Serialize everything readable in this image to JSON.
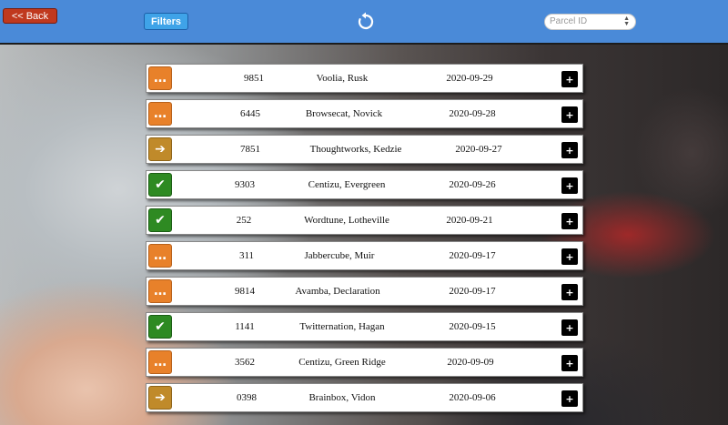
{
  "header": {
    "back_label": "<< Back",
    "filters_label": "Filters",
    "refresh_icon": "refresh-icon",
    "parcel_select_placeholder": "Parcel ID"
  },
  "status_symbols": {
    "pending": "…",
    "transit": "➔",
    "done": "✔"
  },
  "colors": {
    "header": "#4a8ad8",
    "back_button": "#c0391e",
    "filters_button": "#3fa3e8",
    "pending": "#e8812a",
    "transit": "#c08a2a",
    "done": "#2e8a22"
  },
  "parcels": [
    {
      "status": "pending",
      "id": "9851",
      "name": "Voolia, Rusk",
      "date": "2020-09-29"
    },
    {
      "status": "pending",
      "id": "6445",
      "name": "Browsecat, Novick",
      "date": "2020-09-28"
    },
    {
      "status": "transit",
      "id": "7851",
      "name": "Thoughtworks, Kedzie",
      "date": "2020-09-27"
    },
    {
      "status": "done",
      "id": "9303",
      "name": "Centizu, Evergreen",
      "date": "2020-09-26"
    },
    {
      "status": "done",
      "id": "252",
      "name": "Wordtune, Lotheville",
      "date": "2020-09-21"
    },
    {
      "status": "pending",
      "id": "311",
      "name": "Jabbercube, Muir",
      "date": "2020-09-17"
    },
    {
      "status": "pending",
      "id": "9814",
      "name": "Avamba, Declaration",
      "date": "2020-09-17"
    },
    {
      "status": "done",
      "id": "1141",
      "name": "Twitternation, Hagan",
      "date": "2020-09-15"
    },
    {
      "status": "pending",
      "id": "3562",
      "name": "Centizu, Green Ridge",
      "date": "2020-09-09"
    },
    {
      "status": "transit",
      "id": "0398",
      "name": "Brainbox, Vidon",
      "date": "2020-09-06"
    }
  ],
  "row_action_label": "+"
}
